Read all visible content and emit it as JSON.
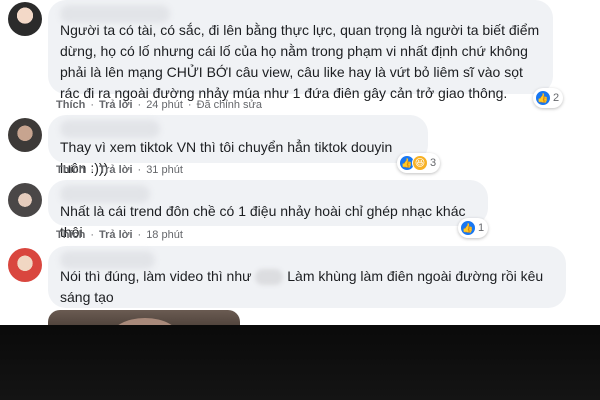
{
  "comments": [
    {
      "text": "Người ta có tài, có sắc, đi lên bằng thực lực, quan trọng là người ta biết điểm dừng, họ có lố nhưng cái lố của họ nằm trong phạm vi nhất định chứ không phải là lên mạng CHỬI BỚI câu view, câu like hay là vứt bỏ liêm sĩ vào sọt rác đi ra ngoài đường nhảy múa như 1 đứa điên gây cản trở giao thông.",
      "like_label": "Thích",
      "reply_label": "Trả lời",
      "time": "24 phút",
      "edited": "Đã chỉnh sửa",
      "reaction_count": "2"
    },
    {
      "text": "Thay vì xem tiktok VN thì tôi chuyển hẳn tiktok douyin luôn :)))",
      "like_label": "Thích",
      "reply_label": "Trả lời",
      "time": "31 phút",
      "reaction_count": "3"
    },
    {
      "text": "Nhất là cái trend đôn chề có 1 điệu nhảy hoài chỉ ghép nhạc khác thôi",
      "like_label": "Thích",
      "reply_label": "Trả lời",
      "time": "18 phút",
      "reaction_count": "1"
    },
    {
      "text_before": "Nói thì đúng, làm video thì như",
      "text_after": "Làm khùng làm điên ngoài đường rồi kêu sáng tạo"
    }
  ],
  "colors": {
    "bubble_bg": "#f0f2f5",
    "like_blue": "#1877f2",
    "haha_yellow": "#f7b125",
    "meta_gray": "#65676b"
  },
  "icons": [
    "like-reaction-icon",
    "haha-reaction-icon"
  ]
}
